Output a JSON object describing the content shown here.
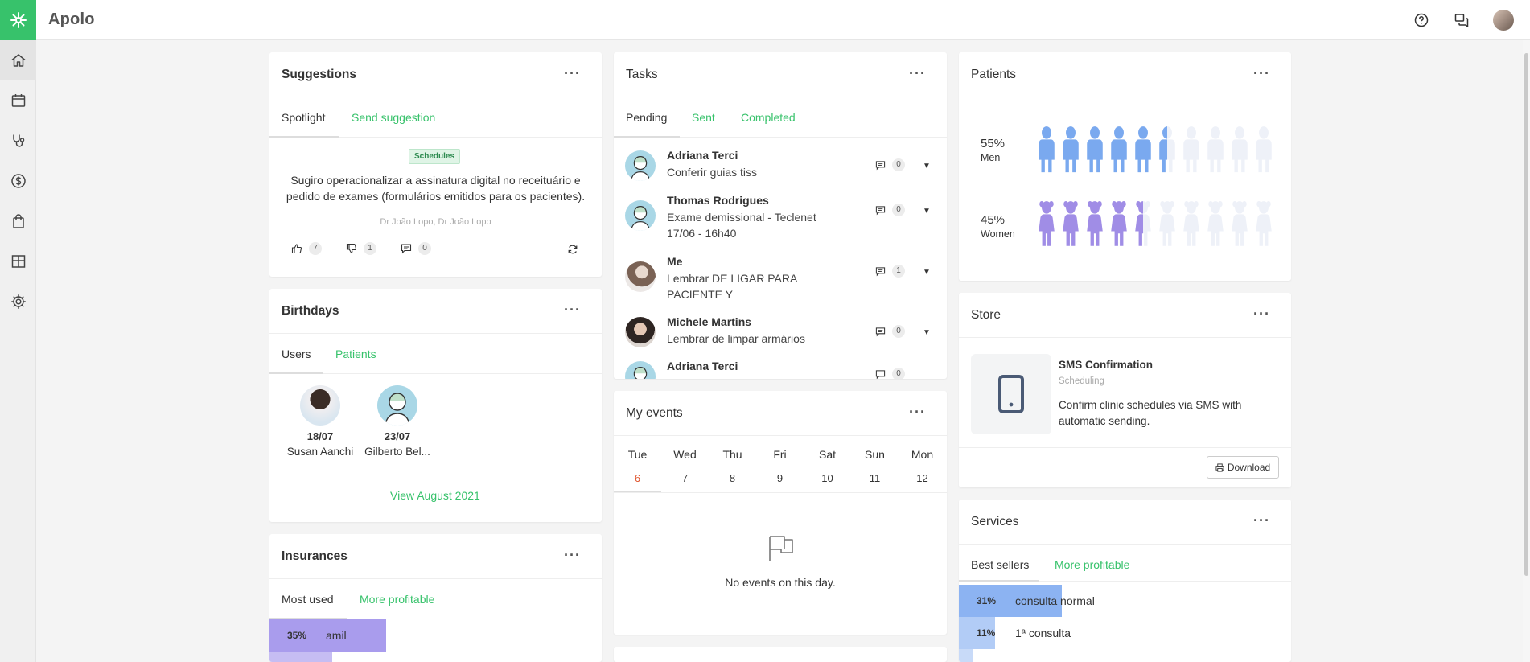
{
  "app": {
    "brand": "Apolo"
  },
  "colors": {
    "accent": "#37c26b",
    "men": "#7aa9ef",
    "women": "#a08de6",
    "today": "#e0552e"
  },
  "topbar": {
    "icons": [
      "help-icon",
      "chat-icon"
    ]
  },
  "sidebar": {
    "items": [
      "home-icon",
      "calendar-icon",
      "stethoscope-icon",
      "dollar-icon",
      "shopping-bag-icon",
      "dashboard-icon",
      "settings-icon"
    ]
  },
  "suggestions": {
    "title": "Suggestions",
    "menu": "···",
    "tabs": [
      "Spotlight",
      "Send suggestion"
    ],
    "tag": "Schedules",
    "text": "Sugiro operacionalizar a assinatura digital no receituário e pedido de exames (formulários emitidos para os pacientes).",
    "author": "Dr João Lopo, Dr João Lopo",
    "likes": "7",
    "dislikes": "1",
    "comments": "0"
  },
  "birthdays": {
    "title": "Birthdays",
    "menu": "···",
    "tabs": [
      "Users",
      "Patients"
    ],
    "people": [
      {
        "date": "18/07",
        "name": "Susan Aanchi"
      },
      {
        "date": "23/07",
        "name": "Gilberto Bel..."
      }
    ],
    "link": "View August 2021"
  },
  "insurances": {
    "title": "Insurances",
    "menu": "···",
    "tabs": [
      "Most used",
      "More profitable"
    ],
    "rows": [
      {
        "pct": "35%",
        "label": "amil",
        "value": 35
      }
    ]
  },
  "tasks": {
    "title": "Tasks",
    "menu": "···",
    "tabs": [
      "Pending",
      "Sent",
      "Completed"
    ],
    "items": [
      {
        "name": "Adriana Terci",
        "desc": "Conferir guias tiss",
        "comments": "0"
      },
      {
        "name": "Thomas Rodrigues",
        "desc": "Exame demissional - Teclenet 17/06 - 16h40",
        "comments": "0"
      },
      {
        "name": "Me",
        "desc": "Lembrar DE LIGAR PARA PACIENTE Y",
        "comments": "1"
      },
      {
        "name": "Michele Martins",
        "desc": "Lembrar de limpar armários",
        "comments": "0"
      },
      {
        "name": "Adriana Terci",
        "desc": "",
        "comments": "0"
      }
    ]
  },
  "events": {
    "title": "My events",
    "menu": "···",
    "days": [
      {
        "dow": "Tue",
        "num": "6"
      },
      {
        "dow": "Wed",
        "num": "7"
      },
      {
        "dow": "Thu",
        "num": "8"
      },
      {
        "dow": "Fri",
        "num": "9"
      },
      {
        "dow": "Sat",
        "num": "10"
      },
      {
        "dow": "Sun",
        "num": "11"
      },
      {
        "dow": "Mon",
        "num": "12"
      }
    ],
    "empty": "No events on this day."
  },
  "patients": {
    "title": "Patients",
    "menu": "···",
    "men": {
      "pct": "55%",
      "label": "Men",
      "value": 55
    },
    "women": {
      "pct": "45%",
      "label": "Women",
      "value": 45
    }
  },
  "store": {
    "title": "Store",
    "menu": "···",
    "product": "SMS Confirmation",
    "category": "Scheduling",
    "desc": "Confirm clinic schedules via SMS with automatic sending.",
    "button": "Download"
  },
  "services": {
    "title": "Services",
    "menu": "···",
    "tabs": [
      "Best sellers",
      "More profitable"
    ],
    "rows": [
      {
        "pct": "31%",
        "label": "consulta normal",
        "value": 31
      },
      {
        "pct": "11%",
        "label": "1ª consulta",
        "value": 11
      }
    ]
  }
}
